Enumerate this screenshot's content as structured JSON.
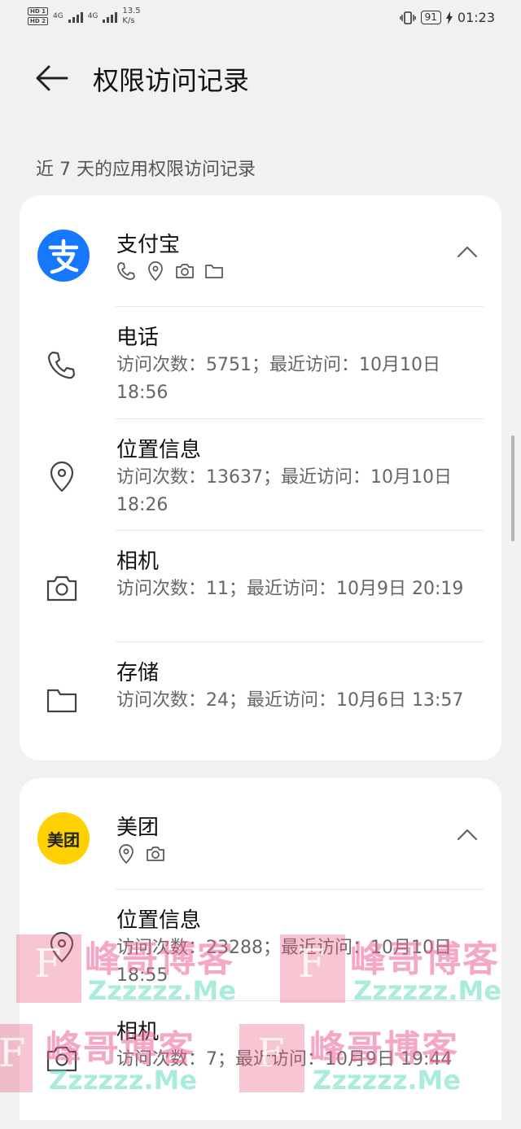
{
  "status_bar": {
    "sim1": "HD 1",
    "sim2": "HD 2",
    "net1": "4G",
    "net2": "4G",
    "speed_value": "13.5",
    "speed_unit": "K/s",
    "battery": "91",
    "time": "01:23"
  },
  "header": {
    "title": "权限访问记录",
    "subtitle": "近 7 天的应用权限访问记录"
  },
  "apps": [
    {
      "name": "支付宝",
      "logo_text": "支",
      "logo_color": "#1677ff",
      "permissions": [
        {
          "icon": "phone-icon",
          "label": "电话",
          "detail": "访问次数：5751；最近访问：10月10日 18:56"
        },
        {
          "icon": "location-icon",
          "label": "位置信息",
          "detail": "访问次数：13637；最近访问：10月10日 18:26"
        },
        {
          "icon": "camera-icon",
          "label": "相机",
          "detail": "访问次数：11；最近访问：10月9日 20:19"
        },
        {
          "icon": "folder-icon",
          "label": "存储",
          "detail": "访问次数：24；最近访问：10月6日 13:57"
        }
      ]
    },
    {
      "name": "美团",
      "logo_text": "美团",
      "logo_color": "#ffd100",
      "permissions": [
        {
          "icon": "location-icon",
          "label": "位置信息",
          "detail": "访问次数：23288；最近访问：10月10日 18:55"
        },
        {
          "icon": "camera-icon",
          "label": "相机",
          "detail": "访问次数：7；最近访问：10月9日 19:44"
        }
      ]
    }
  ],
  "watermark": {
    "letter": "F",
    "text": "峰哥博客",
    "url": "Zzzzzz.Me"
  }
}
